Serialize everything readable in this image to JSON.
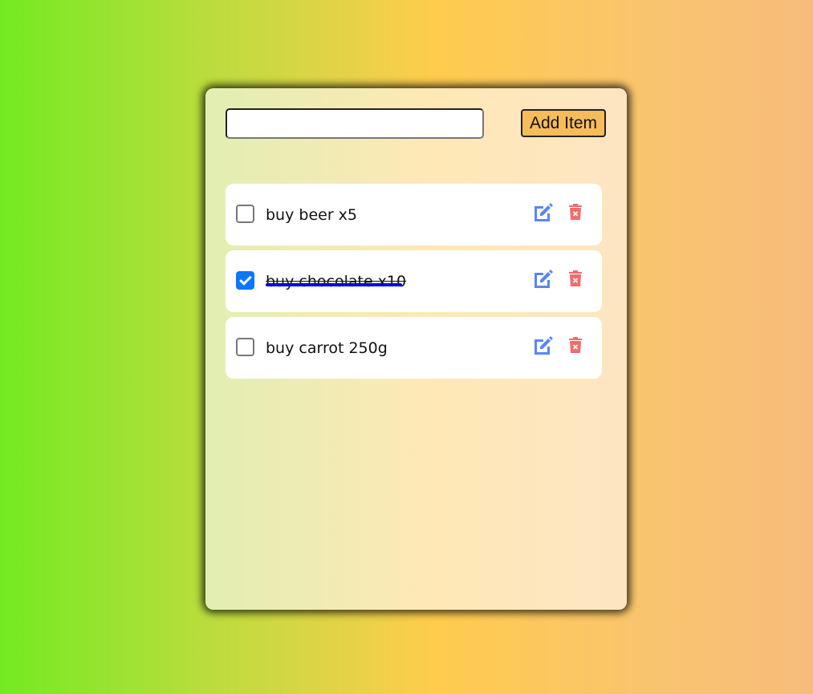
{
  "input": {
    "value": "",
    "placeholder": ""
  },
  "add_button": {
    "label": "Add Item"
  },
  "items": [
    {
      "text": "buy beer x5",
      "done": false
    },
    {
      "text": "buy chocolate x10",
      "done": true
    },
    {
      "text": "buy carrot 250g",
      "done": false
    }
  ],
  "colors": {
    "edit": "#5b86f0",
    "delete": "#f26b6b",
    "checked": "#0b76ff",
    "strike": "#0000ee",
    "button": "#f7bc5a"
  }
}
